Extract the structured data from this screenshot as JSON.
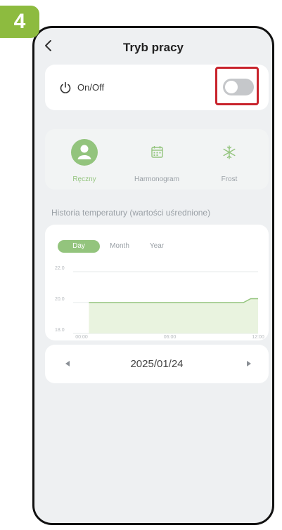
{
  "step": {
    "number": "4"
  },
  "header": {
    "title": "Tryb pracy"
  },
  "power": {
    "label": "On/Off",
    "toggle_on": false
  },
  "modes": [
    {
      "label": "Ręczny",
      "active": true
    },
    {
      "label": "Harmonogram",
      "active": false
    },
    {
      "label": "Frost",
      "active": false
    }
  ],
  "history": {
    "title": "Historia temperatury (wartości uśrednione)",
    "tabs": [
      "Day",
      "Month",
      "Year"
    ],
    "active_tab": "Day"
  },
  "chart_data": {
    "type": "area",
    "x_ticks": [
      "00:00",
      "06:00",
      "12:00"
    ],
    "y_ticks": [
      "22.0",
      "20.0",
      "18.0"
    ],
    "ylim": [
      18.0,
      22.0
    ],
    "series": [
      {
        "x": [
          "00:30",
          "11:00",
          "11:30",
          "12:00"
        ],
        "values": [
          20.0,
          20.0,
          20.25,
          20.25
        ]
      }
    ],
    "grid": true
  },
  "date_nav": {
    "date": "2025/01/24"
  },
  "colors": {
    "accent": "#93c47d",
    "badge": "#8dbb3f",
    "highlight": "#c8232c"
  }
}
